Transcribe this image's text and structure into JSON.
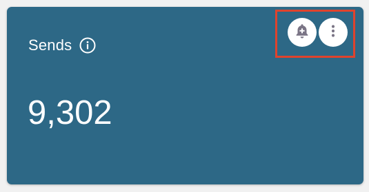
{
  "card": {
    "title": "Sends",
    "value": "9,302"
  },
  "icons": {
    "info": "info-circle-icon",
    "alert": "bell-plus-icon",
    "more": "more-vertical-icon"
  },
  "colors": {
    "card_background": "#2d6886",
    "page_background": "#f1f1f1",
    "text": "#ffffff",
    "icon_fill": "#7a7485",
    "highlight": "#e0432d"
  }
}
